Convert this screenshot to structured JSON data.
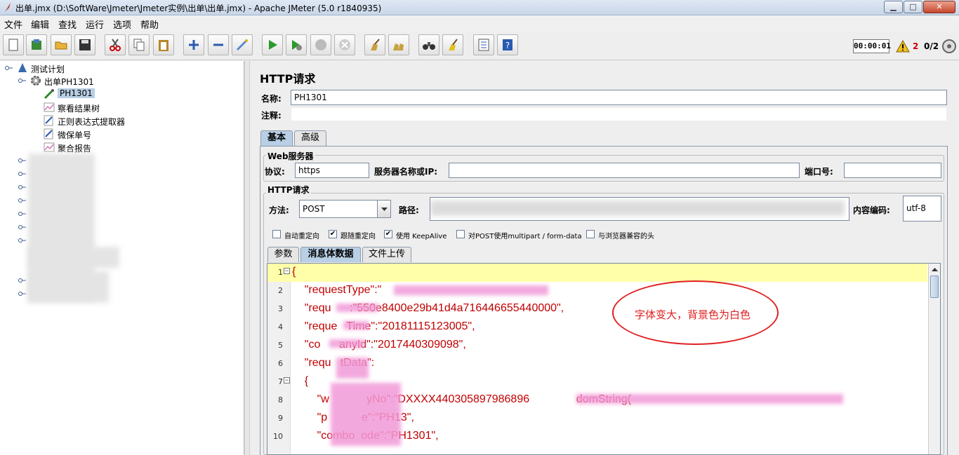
{
  "window": {
    "title": "出单.jmx (D:\\SoftWare\\Jmeter\\Jmeter实例\\出单\\出单.jmx) - Apache JMeter (5.0 r1840935)",
    "minimize": "▁",
    "maximize": "□",
    "close": "✕"
  },
  "menu": [
    "文件",
    "编辑",
    "查找",
    "运行",
    "选项",
    "帮助"
  ],
  "status": {
    "timer": "00:00:01",
    "warnings": "2",
    "threads": "0/2"
  },
  "tree": {
    "root": "测试计划",
    "group": "出单PH1301",
    "children": [
      "PH1301",
      "察看结果树",
      "正则表达式提取器",
      "微保单号",
      "聚合报告"
    ]
  },
  "panel": {
    "title": "HTTP请求",
    "name_label": "名称:",
    "name_value": "PH1301",
    "comment_label": "注释:",
    "tabs": [
      "基本",
      "高级"
    ],
    "web_server": {
      "title": "Web服务器",
      "protocol_label": "协议:",
      "protocol_value": "https",
      "server_label": "服务器名称或IP:",
      "port_label": "端口号:"
    },
    "http_request": {
      "title": "HTTP请求",
      "method_label": "方法:",
      "method_value": "POST",
      "path_label": "路径:",
      "encoding_label": "内容编码:",
      "encoding_value": "utf-8"
    },
    "checkboxes": [
      {
        "label": "自动重定向",
        "checked": false
      },
      {
        "label": "跟随重定向",
        "checked": true
      },
      {
        "label": "使用 KeepAlive",
        "checked": true
      },
      {
        "label": "对POST使用multipart / form-data",
        "checked": false
      },
      {
        "label": "与浏览器兼容的头",
        "checked": false
      }
    ],
    "body_tabs": [
      "参数",
      "消息体数据",
      "文件上传"
    ]
  },
  "editor": {
    "lines": [
      {
        "n": "1",
        "text": "{",
        "fold": "⊟"
      },
      {
        "n": "2",
        "text": "    \"requestType\":\"",
        "fold": ""
      },
      {
        "n": "3",
        "text": "    \"requ      :\"550e8400e29b41d4a716446655440000\",",
        "fold": ""
      },
      {
        "n": "4",
        "text": "    \"reque   Time\":\"20181115123005\",",
        "fold": ""
      },
      {
        "n": "5",
        "text": "    \"co      anyId\":\"2017440309098\",",
        "fold": ""
      },
      {
        "n": "6",
        "text": "    \"requ   tData\":",
        "fold": ""
      },
      {
        "n": "7",
        "text": "    {",
        "fold": "⊟"
      },
      {
        "n": "8",
        "text": "        \"w            yNo\":\"DXXXX440305897986896               domString(",
        "fold": ""
      },
      {
        "n": "9",
        "text": "        \"p           e\":\"PH13\",",
        "fold": ""
      },
      {
        "n": "10",
        "text": "        \"combo  ode\":\"PH1301\",",
        "fold": ""
      }
    ]
  },
  "annotation": {
    "text": "字体变大，背景色为白色",
    "color": "#e02020"
  }
}
